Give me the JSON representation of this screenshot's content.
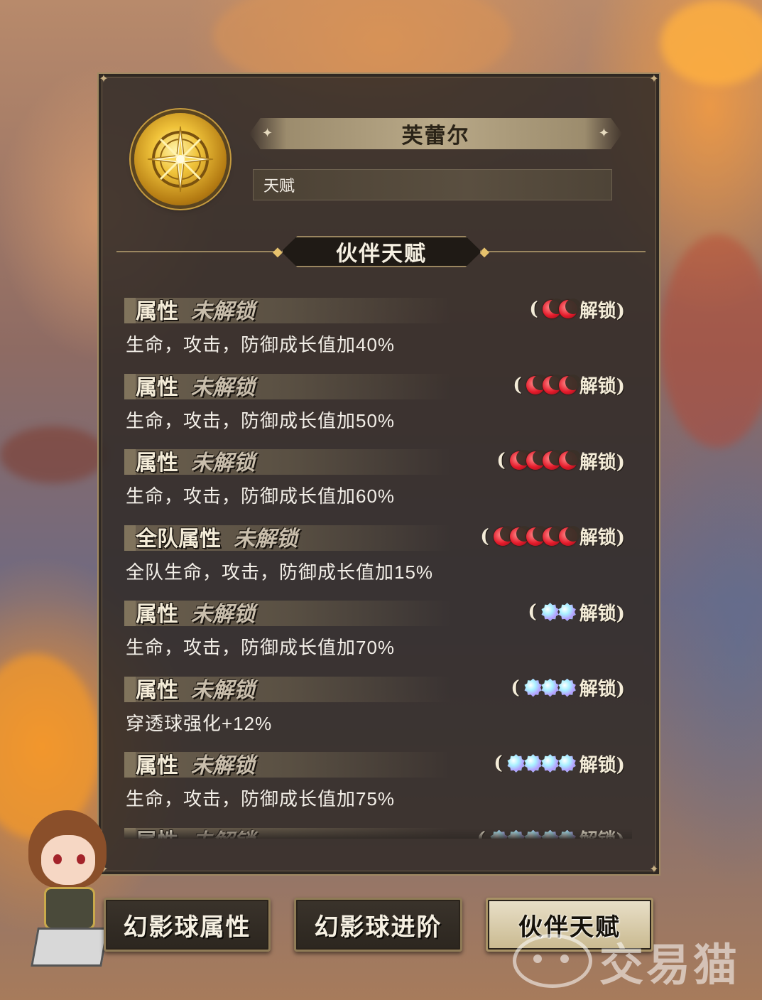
{
  "hero": {
    "name": "芙蕾尔",
    "subtitle": "天赋",
    "emblem_icon": "golden-compass-star-icon"
  },
  "section_title": "伙伴天赋",
  "req_open": "(",
  "req_close": "解锁)",
  "talents": [
    {
      "title": "属性",
      "status": "未解锁",
      "desc": "生命，攻击，防御成长值加40%",
      "req_icon": "red-moon-icon",
      "req_count": 2
    },
    {
      "title": "属性",
      "status": "未解锁",
      "desc": "生命，攻击，防御成长值加50%",
      "req_icon": "red-moon-icon",
      "req_count": 3
    },
    {
      "title": "属性",
      "status": "未解锁",
      "desc": "生命，攻击，防御成长值加60%",
      "req_icon": "red-moon-icon",
      "req_count": 4
    },
    {
      "title": "全队属性",
      "status": "未解锁",
      "desc": "全队生命，攻击，防御成长值加15%",
      "req_icon": "red-moon-icon",
      "req_count": 5
    },
    {
      "title": "属性",
      "status": "未解锁",
      "desc": "生命，攻击，防御成长值加70%",
      "req_icon": "rainbow-gem-icon",
      "req_count": 2
    },
    {
      "title": "属性",
      "status": "未解锁",
      "desc": "穿透球强化+12%",
      "req_icon": "rainbow-gem-icon",
      "req_count": 3
    },
    {
      "title": "属性",
      "status": "未解锁",
      "desc": "生命，攻击，防御成长值加75%",
      "req_icon": "rainbow-gem-icon",
      "req_count": 4
    },
    {
      "title": "属性",
      "status": "未解锁",
      "desc": "",
      "req_icon": "rainbow-gem-icon",
      "req_count": 5
    }
  ],
  "tabs": [
    {
      "label": "幻影球属性",
      "active": false
    },
    {
      "label": "幻影球进阶",
      "active": false
    },
    {
      "label": "伙伴天赋",
      "active": true
    }
  ],
  "watermark": "交易猫",
  "colors": {
    "panel_bg": "#302a26",
    "panel_border": "#a18a63",
    "gold": "#f0c33a",
    "moon_red": "#e41a2a",
    "active_tab_bg": "#e9e0c9"
  }
}
